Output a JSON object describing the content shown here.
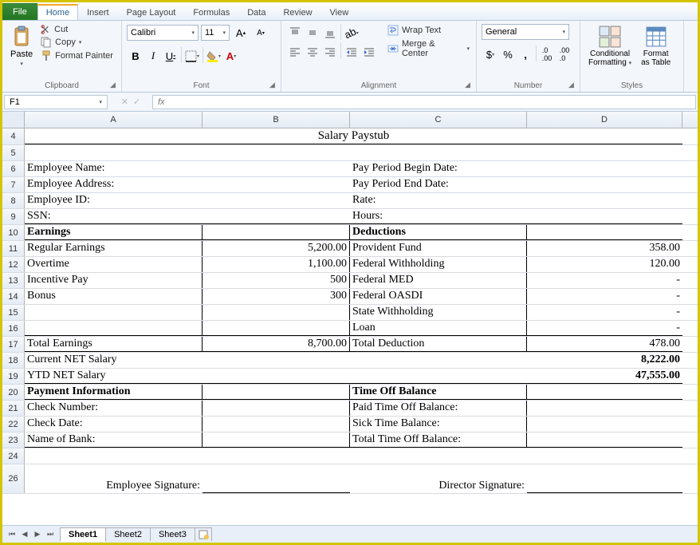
{
  "tabs": {
    "file": "File",
    "items": [
      "Home",
      "Insert",
      "Page Layout",
      "Formulas",
      "Data",
      "Review",
      "View"
    ],
    "active": "Home"
  },
  "ribbon": {
    "clipboard": {
      "label": "Clipboard",
      "paste": "Paste",
      "cut": "Cut",
      "copy": "Copy",
      "painter": "Format Painter"
    },
    "font": {
      "label": "Font",
      "name": "Calibri",
      "size": "11"
    },
    "alignment": {
      "label": "Alignment",
      "wrap": "Wrap Text",
      "merge": "Merge & Center"
    },
    "number": {
      "label": "Number",
      "format": "General"
    },
    "styles": {
      "label": "Styles",
      "cond": "Conditional Formatting",
      "cond1": "Conditional",
      "cond2": "Formatting",
      "table": "Format as Table",
      "table1": "Format",
      "table2": "as Table"
    }
  },
  "namebox": "F1",
  "columns": [
    "A",
    "B",
    "C",
    "D"
  ],
  "rows": {
    "r4": {
      "title": "Salary Paystub"
    },
    "r6": {
      "a": "Employee Name:",
      "c": "Pay Period Begin Date:"
    },
    "r7": {
      "a": "Employee Address:",
      "c": "Pay Period End Date:"
    },
    "r8": {
      "a": "Employee ID:",
      "c": "Rate:"
    },
    "r9": {
      "a": "SSN:",
      "c": "Hours:"
    },
    "r10": {
      "a": "Earnings",
      "c": "Deductions"
    },
    "r11": {
      "a": "Regular Earnings",
      "b": "5,200.00",
      "c": "Provident Fund",
      "d": "358.00"
    },
    "r12": {
      "a": "Overtime",
      "b": "1,100.00",
      "c": "Federal Withholding",
      "d": "120.00"
    },
    "r13": {
      "a": "Incentive Pay",
      "b": "500",
      "c": "Federal MED",
      "d": "-"
    },
    "r14": {
      "a": "Bonus",
      "b": "300",
      "c": "Federal OASDI",
      "d": "-"
    },
    "r15": {
      "c": "State Withholding",
      "d": "-"
    },
    "r16": {
      "c": "Loan",
      "d": "-"
    },
    "r17": {
      "a": "Total Earnings",
      "b": "8,700.00",
      "c": "Total Deduction",
      "d": "478.00"
    },
    "r18": {
      "a": "Current NET Salary",
      "d": "8,222.00"
    },
    "r19": {
      "a": "YTD NET Salary",
      "d": "47,555.00"
    },
    "r20": {
      "a": "Payment Information",
      "c": "Time Off Balance"
    },
    "r21": {
      "a": "Check  Number:",
      "c": "Paid Time Off Balance:"
    },
    "r22": {
      "a": "Check Date:",
      "c": "Sick Time Balance:"
    },
    "r23": {
      "a": "Name of Bank:",
      "c": "Total Time Off Balance:"
    },
    "r26": {
      "a": "Employee Signature:",
      "c": "Director  Signature:"
    }
  },
  "sheets": [
    "Sheet1",
    "Sheet2",
    "Sheet3"
  ],
  "chart_data": {
    "type": "table",
    "title": "Salary Paystub",
    "employee_info": {
      "name": "",
      "address": "",
      "id": "",
      "ssn": ""
    },
    "pay_period": {
      "begin_date": "",
      "end_date": "",
      "rate": "",
      "hours": ""
    },
    "earnings": [
      {
        "item": "Regular Earnings",
        "amount": 5200.0
      },
      {
        "item": "Overtime",
        "amount": 1100.0
      },
      {
        "item": "Incentive Pay",
        "amount": 500
      },
      {
        "item": "Bonus",
        "amount": 300
      }
    ],
    "total_earnings": 8700.0,
    "deductions": [
      {
        "item": "Provident Fund",
        "amount": 358.0
      },
      {
        "item": "Federal Withholding",
        "amount": 120.0
      },
      {
        "item": "Federal MED",
        "amount": null
      },
      {
        "item": "Federal OASDI",
        "amount": null
      },
      {
        "item": "State Withholding",
        "amount": null
      },
      {
        "item": "Loan",
        "amount": null
      }
    ],
    "total_deduction": 478.0,
    "current_net_salary": 8222.0,
    "ytd_net_salary": 47555.0
  }
}
